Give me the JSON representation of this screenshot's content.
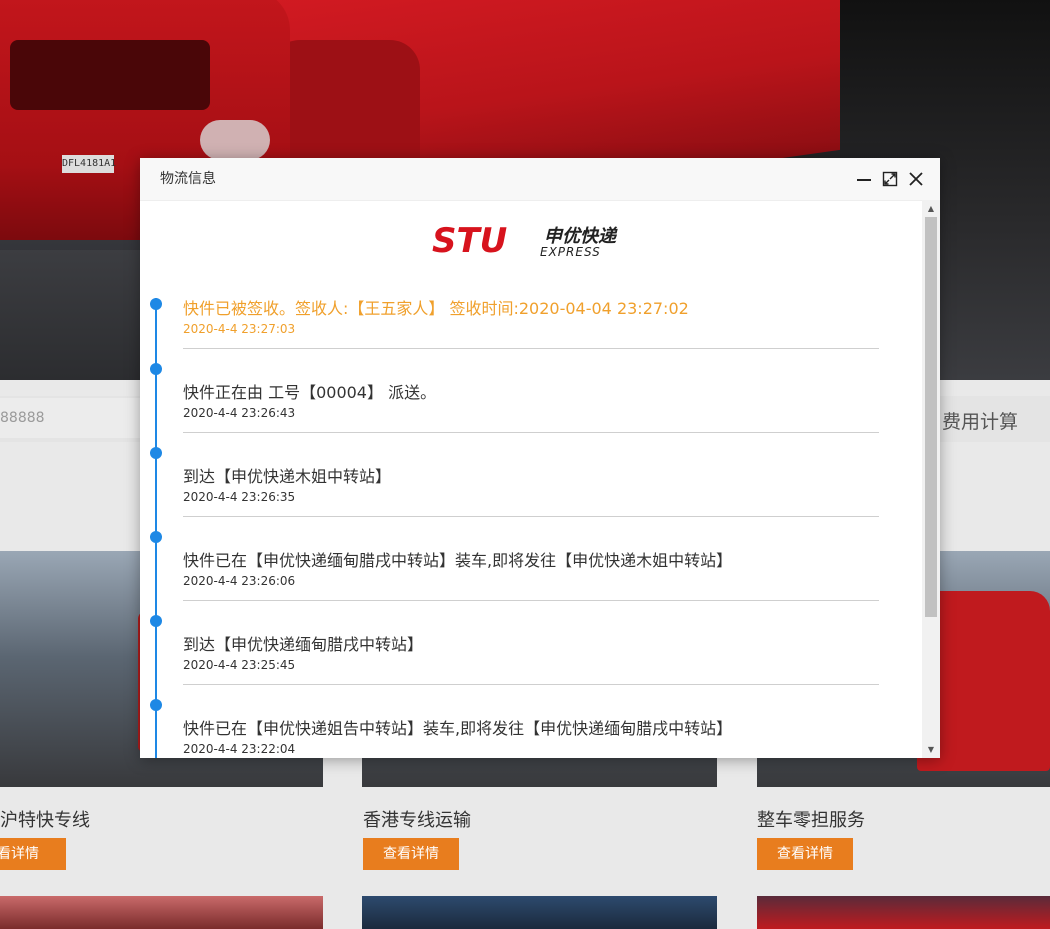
{
  "background": {
    "truck_plate": "DFL4181A1",
    "search_placeholder": "88888",
    "fee_link": "费用计算",
    "cards": [
      {
        "title": "沪特快专线",
        "button": "看详情"
      },
      {
        "title": "香港专线运输",
        "button": "查看详情"
      },
      {
        "title": "整车零担服务",
        "button": "查看详情"
      }
    ]
  },
  "modal": {
    "title": "物流信息",
    "logo": {
      "brand": "STU",
      "cn": "申优快递",
      "en": "EXPRESS"
    },
    "events": [
      {
        "text": "快件已被签收。签收人:【王五家人】 签收时间:2020-04-04 23:27:02",
        "time": "2020-4-4 23:27:03"
      },
      {
        "text": "快件正在由 工号【00004】 派送。",
        "time": "2020-4-4 23:26:43"
      },
      {
        "text": "到达【申优快递木姐中转站】",
        "time": "2020-4-4 23:26:35"
      },
      {
        "text": "快件已在【申优快递缅甸腊戌中转站】装车,即将发往【申优快递木姐中转站】",
        "time": "2020-4-4 23:26:06"
      },
      {
        "text": "到达【申优快递缅甸腊戌中转站】",
        "time": "2020-4-4 23:25:45"
      },
      {
        "text": "快件已在【申优快递姐告中转站】装车,即将发往【申优快递缅甸腊戌中转站】",
        "time": "2020-4-4 23:22:04"
      }
    ],
    "colors": {
      "timeline": "#1e88e5",
      "latest": "#f0a02c",
      "logo_red": "#d7131d"
    }
  }
}
